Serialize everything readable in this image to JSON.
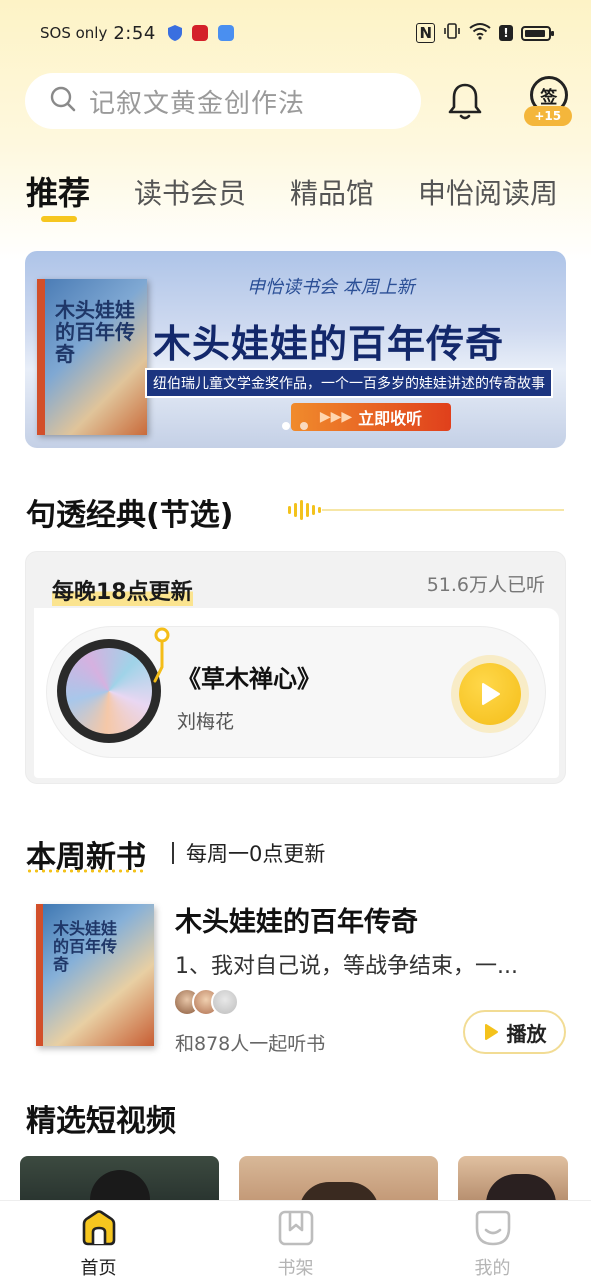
{
  "status_bar": {
    "carrier": "SOS only",
    "time": "2:54",
    "app_icons": [
      "shield-icon",
      "red-app-icon",
      "mail-app-icon"
    ],
    "right_icons": [
      "nfc-icon",
      "vibrate-icon",
      "wifi-icon",
      "alert-icon",
      "battery-icon"
    ]
  },
  "search": {
    "placeholder": "记叙文黄金创作法"
  },
  "signin": {
    "label": "签",
    "points": "+15"
  },
  "tabs": [
    {
      "label": "推荐",
      "active": true
    },
    {
      "label": "读书会员",
      "active": false
    },
    {
      "label": "精品馆",
      "active": false
    },
    {
      "label": "申怡阅读周",
      "active": false
    }
  ],
  "banner": {
    "top_text": "申怡读书会 本周上新",
    "title": "木头娃娃的百年传奇",
    "subtitle": "纽伯瑞儿童文学金奖作品，一个一百多岁的娃娃讲述的传奇故事",
    "cta": "立即收听",
    "book_cover_text": "木头娃娃的百年传奇",
    "dots": 2,
    "active_dot": 0
  },
  "classic": {
    "heading": "句透经典(节选)",
    "update_label": "每晚18点更新",
    "listeners": "51.6万人已听",
    "book_title": "《草木禅心》",
    "author": "刘梅花"
  },
  "new_books": {
    "heading": "本周新书",
    "subheading": "每周一0点更新",
    "book": {
      "title": "木头娃娃的百年传奇",
      "cover_text": "木头娃娃的百年传奇",
      "description": "1、我对自己说，等战争结束，一...",
      "listeners": "和878人一起听书",
      "play_label": "播放"
    }
  },
  "videos": {
    "heading": "精选短视频"
  },
  "bottom_nav": [
    {
      "label": "首页",
      "icon": "home-icon",
      "active": true
    },
    {
      "label": "书架",
      "icon": "bookshelf-icon",
      "active": false
    },
    {
      "label": "我的",
      "icon": "profile-icon",
      "active": false
    }
  ],
  "colors": {
    "accent": "#f6c61f",
    "banner_dark_blue": "#13286b",
    "cta_orange": "#e0401c"
  }
}
